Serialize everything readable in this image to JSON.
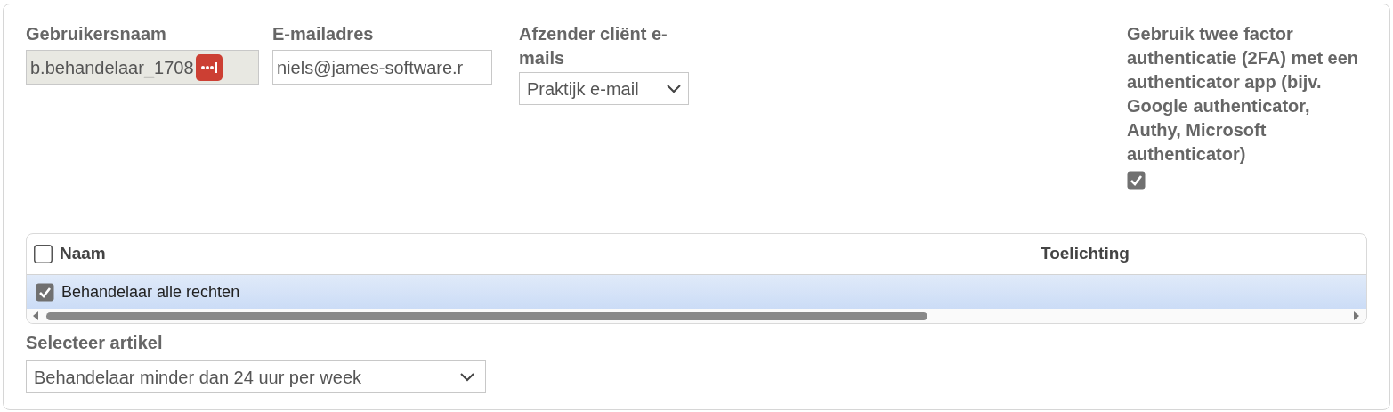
{
  "fields": [
    {
      "kind": "text",
      "label": "Gebruikersnaam",
      "value": "b.behandelaar_1708",
      "disabled": true
    },
    {
      "kind": "text",
      "label": "E-mailadres",
      "value": "niels@james-software.r",
      "disabled": false
    },
    {
      "kind": "select",
      "label": "Afzender cliënt e-mails",
      "value": "Praktijk e-mail"
    }
  ],
  "two_factor": {
    "label": "Gebruik twee factor authenticatie (2FA) met een authenticator app (bijv. Google authenticator, Authy, Microsoft authenticator)",
    "checked": true
  },
  "table": {
    "all_checked": false,
    "columns": [
      "Naam",
      "Toelichting"
    ],
    "rows": [
      {
        "cells": [
          "Behandelaar alle rechten",
          ""
        ],
        "checked": true,
        "selected": true
      }
    ]
  },
  "article": {
    "label": "Selecteer artikel",
    "value": "Behandelaar minder dan 24 uur per week"
  }
}
